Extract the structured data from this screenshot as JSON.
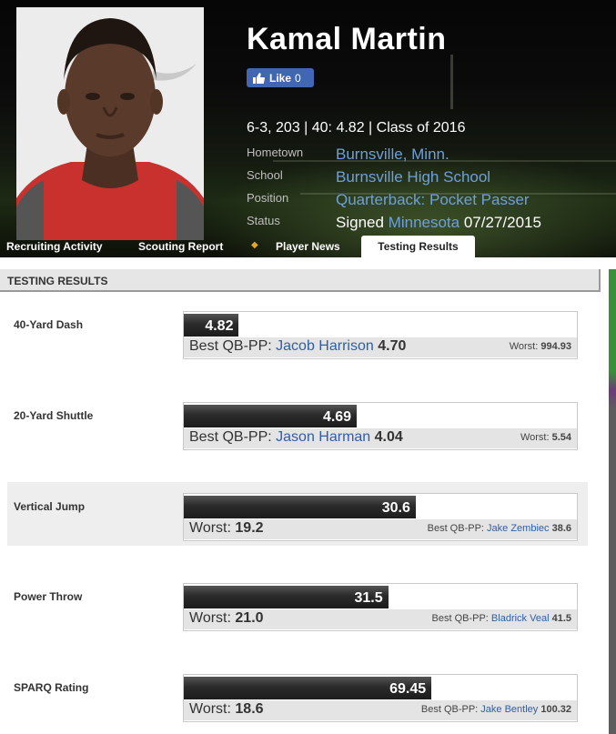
{
  "player": {
    "name": "Kamal Martin",
    "like_label": "Like",
    "like_count": "0",
    "vitals": "6-3, 203 | 40: 4.82 | Class of 2016",
    "hometown_label": "Hometown",
    "hometown": "Burnsville, Minn.",
    "school_label": "School",
    "school": "Burnsville High School",
    "position_label": "Position",
    "position": "Quarterback: Pocket Passer",
    "status_label": "Status",
    "status_prefix": "Signed",
    "status_team": "Minnesota",
    "status_date": "07/27/2015"
  },
  "tabs": [
    {
      "label": "Recruiting Activity"
    },
    {
      "label": "Scouting Report"
    },
    {
      "label": "Player News"
    },
    {
      "label": "Testing Results",
      "active": true
    }
  ],
  "section_title": "TESTING RESULTS",
  "results": [
    {
      "label": "40-Yard Dash",
      "value": "4.82",
      "fill": 0.14,
      "main_prefix": "Best QB-PP:",
      "main_name": "Jacob Harrison",
      "main_value": "4.70",
      "side_prefix": "Worst:",
      "side_name": "",
      "side_value": "994.93"
    },
    {
      "label": "20-Yard Shuttle",
      "value": "4.69",
      "fill": 0.44,
      "main_prefix": "Best QB-PP:",
      "main_name": "Jason Harman",
      "main_value": "4.04",
      "side_prefix": "Worst:",
      "side_name": "",
      "side_value": "5.54"
    },
    {
      "label": "Vertical Jump",
      "value": "30.6",
      "fill": 0.59,
      "main_prefix": "Worst:",
      "main_name": "",
      "main_value": "19.2",
      "side_prefix": "Best QB-PP:",
      "side_name": "Jake Zembiec",
      "side_value": "38.6"
    },
    {
      "label": "Power Throw",
      "value": "31.5",
      "fill": 0.52,
      "main_prefix": "Worst:",
      "main_name": "",
      "main_value": "21.0",
      "side_prefix": "Best QB-PP:",
      "side_name": "Bladrick Veal",
      "side_value": "41.5"
    },
    {
      "label": "SPARQ Rating",
      "value": "69.45",
      "fill": 0.63,
      "main_prefix": "Worst:",
      "main_name": "",
      "main_value": "18.6",
      "side_prefix": "Best QB-PP:",
      "side_name": "Jake Bentley",
      "side_value": "100.32"
    }
  ],
  "colors": {
    "link": "#2f5ea8",
    "header_link": "#6ea0d8",
    "facebook": "#4267b2",
    "tab_separator": "#e2a72a"
  }
}
